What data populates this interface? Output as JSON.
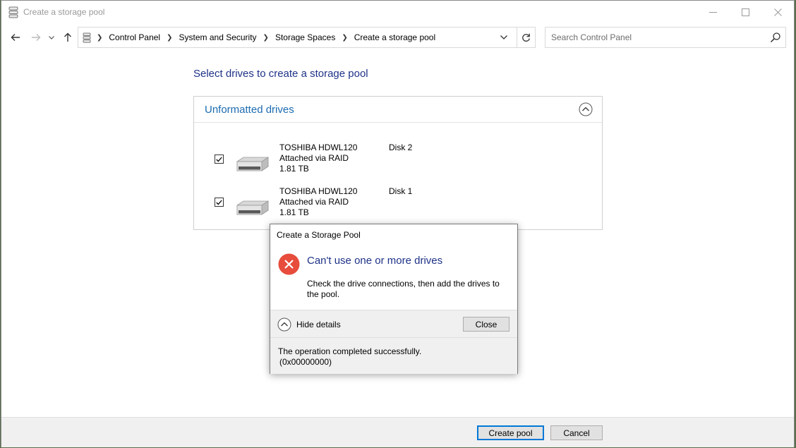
{
  "window": {
    "title": "Create a storage pool"
  },
  "address": {
    "breadcrumbs": [
      "Control Panel",
      "System and Security",
      "Storage Spaces",
      "Create a storage pool"
    ]
  },
  "search": {
    "placeholder": "Search Control Panel"
  },
  "content": {
    "heading": "Select drives to create a storage pool",
    "panel_title": "Unformatted drives",
    "drives": [
      {
        "name": "TOSHIBA HDWL120",
        "connection": "Attached via RAID",
        "size": "1.81 TB",
        "disk": "Disk 2",
        "checked": true
      },
      {
        "name": "TOSHIBA HDWL120",
        "connection": "Attached via RAID",
        "size": "1.81 TB",
        "disk": "Disk 1",
        "checked": true
      }
    ]
  },
  "footer": {
    "create_label": "Create pool",
    "cancel_label": "Cancel"
  },
  "dialog": {
    "title": "Create a Storage Pool",
    "main_message": "Can't use one or more drives",
    "sub_message": "Check the drive connections, then add the drives to the pool.",
    "hide_details_label": "Hide details",
    "close_label": "Close",
    "details_line1": "The operation completed successfully.",
    "details_line2": "(0x00000000)"
  },
  "colors": {
    "heading_blue": "#1e3287",
    "panel_title_blue": "#1c6bb0",
    "error_red": "#e74c3c",
    "primary_button_border": "#0078d7"
  }
}
